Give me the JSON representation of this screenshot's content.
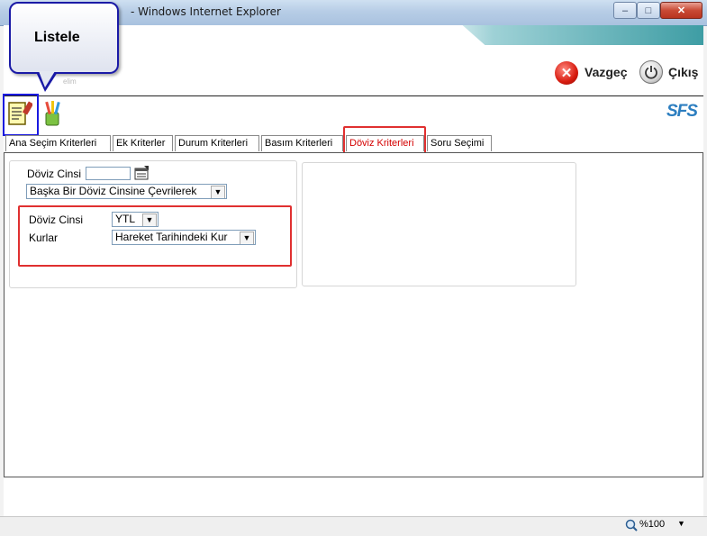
{
  "window": {
    "title": "- Windows Internet Explorer",
    "min_label": "–",
    "max_label": "□",
    "close_label": "✕"
  },
  "header": {
    "vazgec_label": "Vazgeç",
    "cikis_label": "Çıkış",
    "logo_text": "SFS",
    "faint_text": "elim"
  },
  "callout": {
    "text": "Listele"
  },
  "toolbar": {
    "icons": [
      "listele-document-icon",
      "pencils-cup-icon"
    ]
  },
  "tabs": [
    {
      "label": "Ana Seçim Kriterleri",
      "active": false
    },
    {
      "label": "Ek Kriterler",
      "active": false
    },
    {
      "label": "Durum Kriterleri",
      "active": false
    },
    {
      "label": "Basım Kriterleri",
      "active": false
    },
    {
      "label": "Döviz Kriterleri",
      "active": true
    },
    {
      "label": "Soru Seçimi",
      "active": false
    }
  ],
  "form": {
    "doviz_cinsi_label": "Döviz Cinsi",
    "doviz_cinsi_value": "",
    "conversion_select": "Başka Bir Döviz Cinsine Çevrilerek",
    "target_doviz_label": "Döviz Cinsi",
    "target_doviz_select": "YTL",
    "kurlar_label": "Kurlar",
    "kurlar_select": "Hareket Tarihindeki Kur"
  },
  "status": {
    "zoom": "%100"
  },
  "colors": {
    "active_tab": "#d40000",
    "highlight_box": "#e03030",
    "callout_border": "#1a1aa6"
  }
}
